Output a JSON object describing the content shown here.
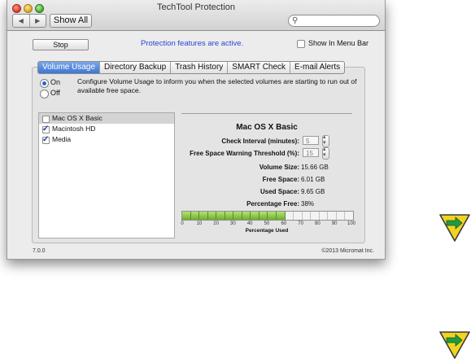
{
  "window": {
    "title": "TechTool Protection"
  },
  "toolbar": {
    "nav_back": "◀",
    "nav_forward": "▶",
    "show_all_label": "Show All",
    "search_placeholder": ""
  },
  "top": {
    "stop_label": "Stop",
    "status_message": "Protection features are active.",
    "show_in_menu_bar_label": "Show In Menu Bar",
    "show_in_menu_bar_checked": false
  },
  "tabs": [
    {
      "label": "Volume Usage",
      "active": true
    },
    {
      "label": "Directory Backup",
      "active": false
    },
    {
      "label": "Trash History",
      "active": false
    },
    {
      "label": "SMART Check",
      "active": false
    },
    {
      "label": "E-mail Alerts",
      "active": false
    }
  ],
  "volume_usage": {
    "on_label": "On",
    "off_label": "Off",
    "selected_mode": "On",
    "description": "Configure Volume Usage to inform you when the selected volumes are starting to run out of available free space.",
    "volumes": [
      {
        "name": "Mac OS X Basic",
        "checked": false,
        "selected": true
      },
      {
        "name": "Macintosh HD",
        "checked": true,
        "selected": false
      },
      {
        "name": "Media",
        "checked": true,
        "selected": false
      }
    ],
    "detail": {
      "volume_name": "Mac OS X Basic",
      "check_interval_label": "Check Interval (minutes):",
      "check_interval_value": "5",
      "threshold_label": "Free Space Warning Threshold (%):",
      "threshold_value": "15",
      "volume_size_label": "Volume Size:",
      "volume_size_value": "15.66 GB",
      "free_space_label": "Free Space:",
      "free_space_value": "6.01 GB",
      "used_space_label": "Used Space:",
      "used_space_value": "9.65 GB",
      "percentage_free_label": "Percentage Free:",
      "percentage_free_value": "38%",
      "percent_used_fraction": 0.62,
      "bar_ticks": [
        "0",
        "10",
        "20",
        "30",
        "40",
        "50",
        "60",
        "70",
        "80",
        "90",
        "100"
      ],
      "bar_caption": "Percentage Used"
    }
  },
  "footer": {
    "version": "7.0.0",
    "copyright": "©2013 Micromat Inc."
  },
  "colors": {
    "accent": "#3d76d4",
    "status_text": "#2a45d8",
    "bar_used": "#8cc63f",
    "sign_yellow": "#f3d321",
    "sign_arrow": "#1f9a3f"
  },
  "icons": [
    "search-icon",
    "next-arrow-sign-icon"
  ]
}
